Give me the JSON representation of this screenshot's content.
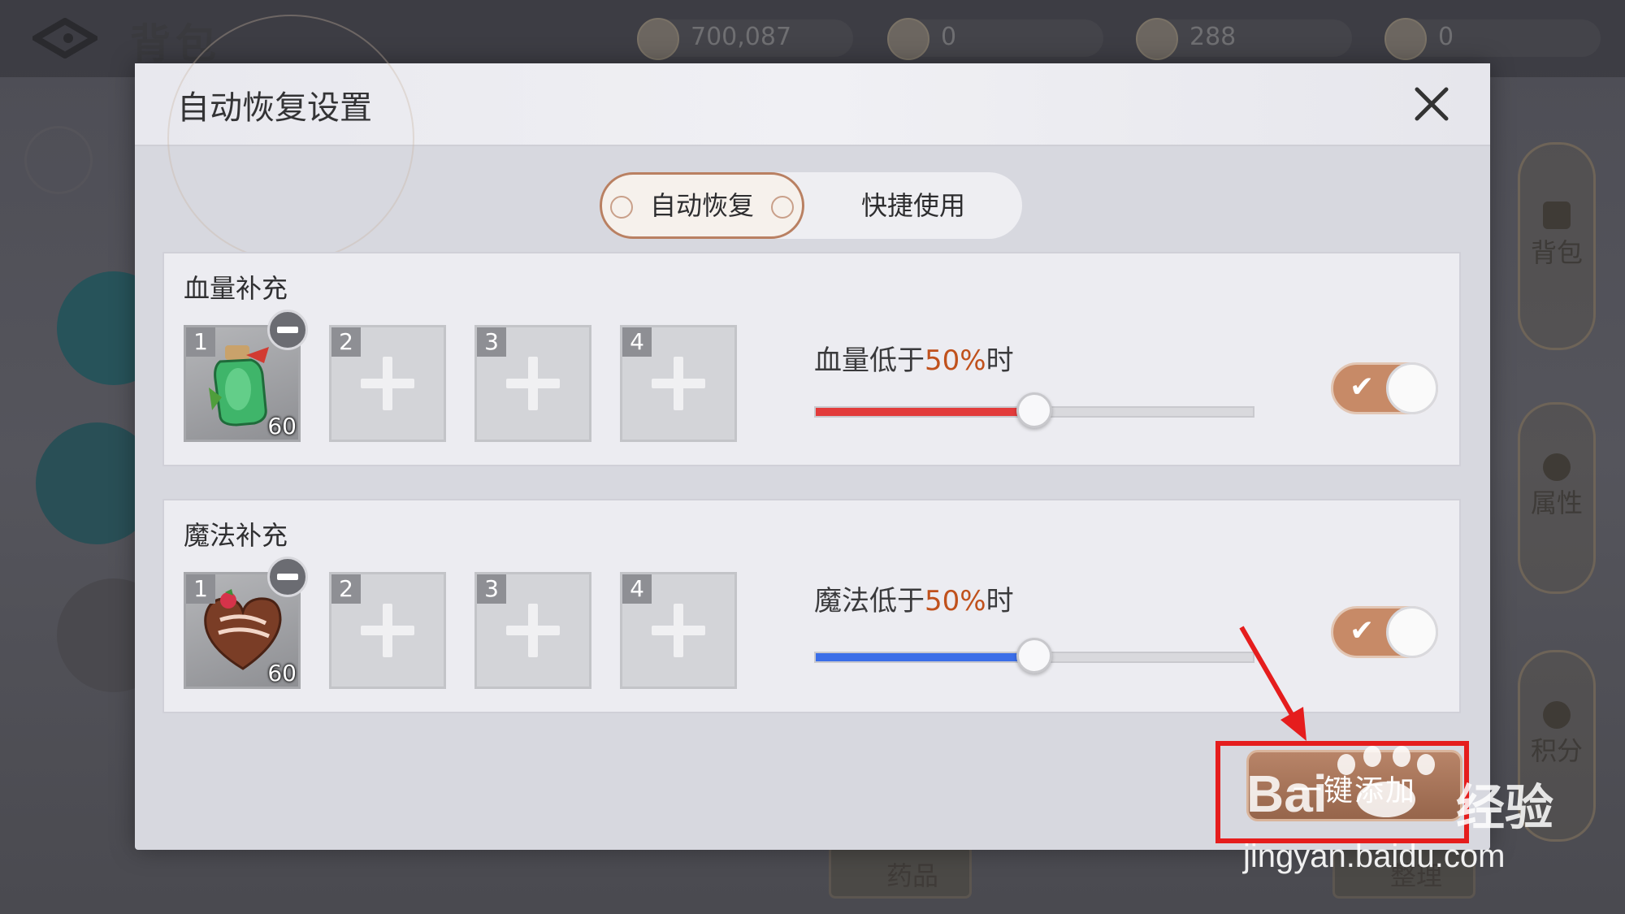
{
  "background": {
    "title": "背包",
    "currencies": [
      "700,087",
      "0",
      "288",
      "0"
    ],
    "side_tabs": [
      "背包",
      "属性",
      "积分"
    ],
    "bottom_buttons": [
      "药品",
      "整理"
    ]
  },
  "modal": {
    "title": "自动恢复设置",
    "tabs": [
      {
        "label": "自动恢复",
        "active": true
      },
      {
        "label": "快捷使用",
        "active": false
      }
    ],
    "hp": {
      "title": "血量补充",
      "threshold_prefix": "血量低于",
      "threshold_value": "50%",
      "threshold_suffix": "时",
      "level": 0.5,
      "fill_color": "#e23b3b",
      "enabled": true,
      "slots": [
        {
          "num": "1",
          "count": "60",
          "item": "green-potion-icon"
        },
        {
          "num": "2"
        },
        {
          "num": "3"
        },
        {
          "num": "4"
        }
      ]
    },
    "mp": {
      "title": "魔法补充",
      "threshold_prefix": "魔法低于",
      "threshold_value": "50%",
      "threshold_suffix": "时",
      "level": 0.5,
      "fill_color": "#3b6ee8",
      "enabled": true,
      "slots": [
        {
          "num": "1",
          "count": "60",
          "item": "chocolate-heart-icon"
        },
        {
          "num": "2"
        },
        {
          "num": "3"
        },
        {
          "num": "4"
        }
      ]
    },
    "one_key_add": "一键添加"
  },
  "watermark": {
    "brand": "Bai",
    "brand2": "经验",
    "url": "jingyan.baidu.com"
  },
  "colors": {
    "accent": "#c78a67",
    "annotation": "#e51d1d"
  }
}
